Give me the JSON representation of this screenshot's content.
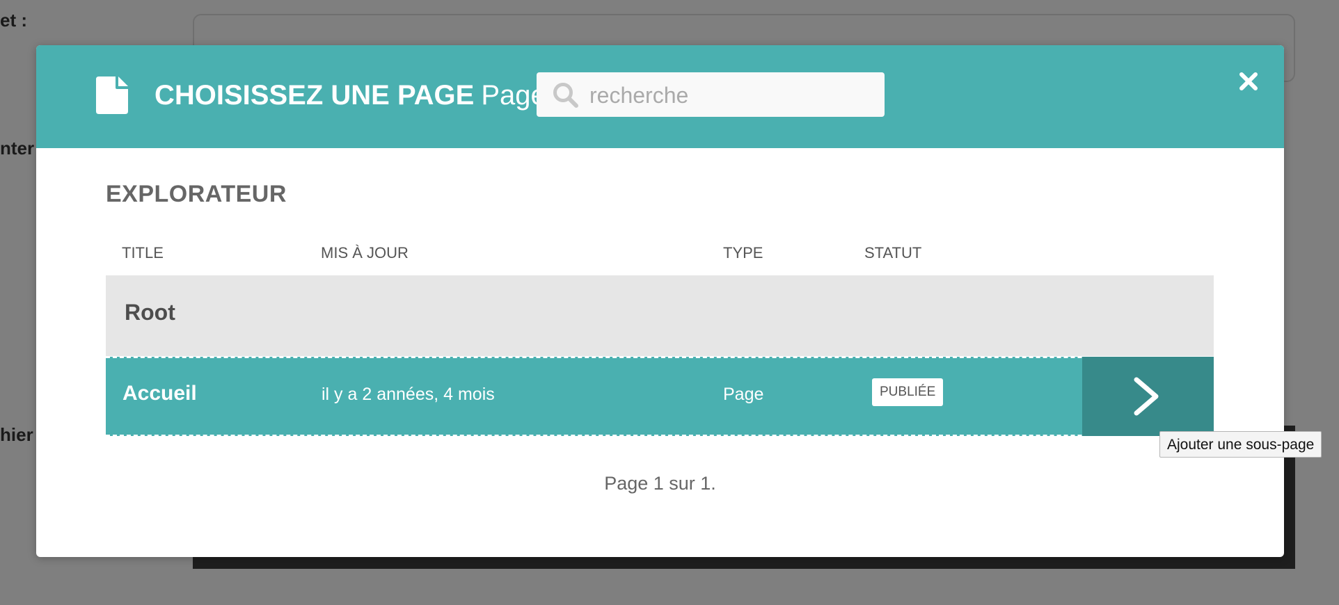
{
  "background": {
    "labels": [
      "et :",
      "nter",
      "hier"
    ]
  },
  "modal": {
    "title_strong": "CHOISISSEZ UNE PAGE",
    "title_light": "Page",
    "search": {
      "placeholder": "recherche",
      "value": ""
    },
    "section_title": "EXPLORATEUR",
    "columns": {
      "title": "TITLE",
      "updated": "MIS À JOUR",
      "type": "TYPE",
      "status": "STATUT"
    },
    "root_row": {
      "title": "Root"
    },
    "rows": [
      {
        "title": "Accueil",
        "updated": "il y a 2 années, 4 mois",
        "type": "Page",
        "status": "PUBLIÉE"
      }
    ],
    "pagination": "Page 1 sur 1.",
    "tooltip": "Ajouter une sous-page"
  },
  "colors": {
    "accent": "#4ab0b0",
    "accent_dark": "#378a8a",
    "overlay": "#7f7f7f"
  },
  "icons": {
    "header": "page-icon",
    "search": "search-icon",
    "close": "close-icon",
    "row_action": "chevron-right-icon"
  }
}
